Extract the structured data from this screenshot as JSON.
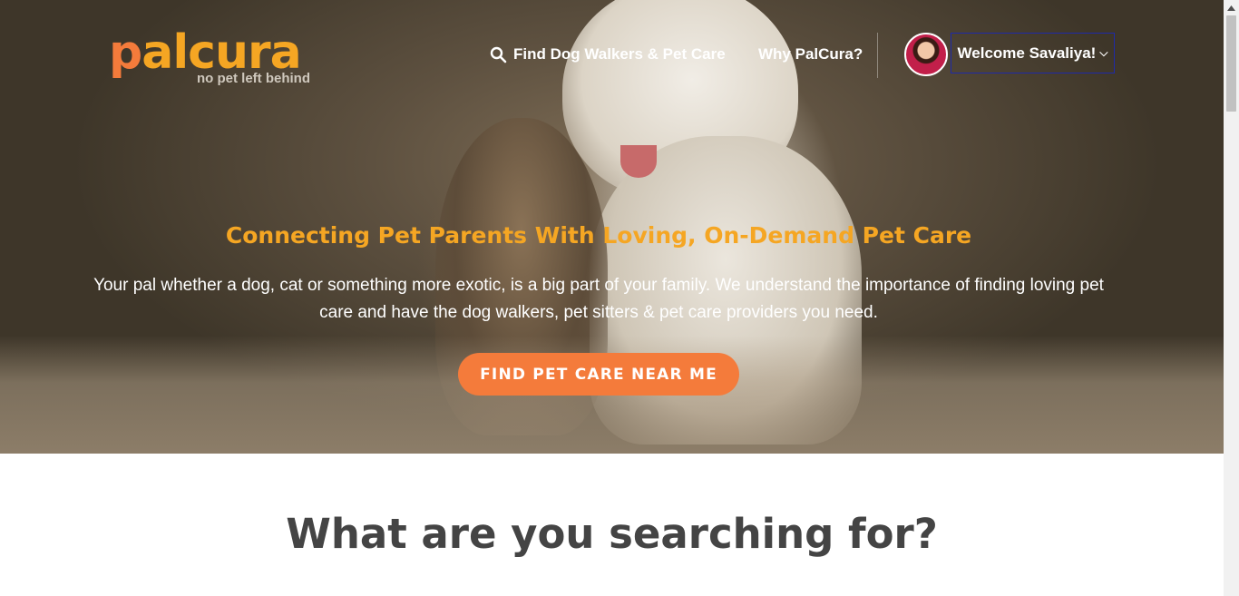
{
  "brand": {
    "logo_text_lead": "p",
    "logo_text_rest": "alcura",
    "tagline": "no pet left behind",
    "colors": {
      "orange": "#f47b3b",
      "yellow": "#f5a623"
    }
  },
  "nav": {
    "find_label": "Find Dog Walkers & Pet Care",
    "find_icon": "search-icon",
    "why_label": "Why PalCura?",
    "welcome_label": "Welcome Savaliya!",
    "welcome_icon": "chevron-down-icon"
  },
  "hero": {
    "headline": "Connecting Pet Parents With Loving, On-Demand Pet Care",
    "subtext": "Your pal whether a dog, cat or something more exotic, is a big part of your family. We understand the importance of finding loving pet care and have the dog walkers, pet sitters & pet care providers you need.",
    "cta_label": "FIND PET CARE NEAR ME"
  },
  "section": {
    "title": "What are you searching for?"
  }
}
